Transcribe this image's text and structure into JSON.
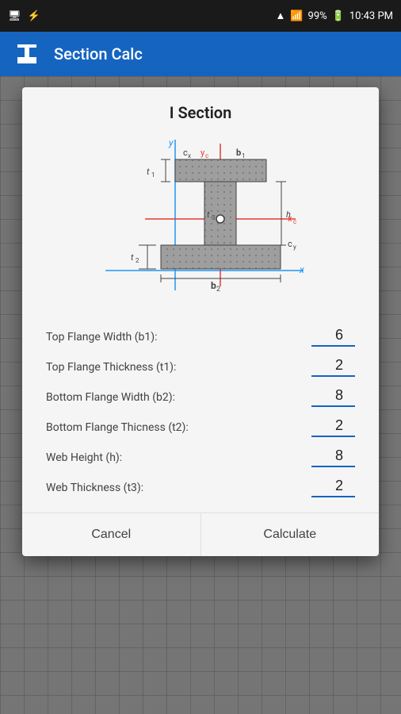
{
  "status_bar": {
    "battery": "99%",
    "time": "10:43 PM",
    "wifi_icon": "wifi",
    "signal_icon": "signal",
    "usb_icon": "usb"
  },
  "app_bar": {
    "title": "Section Calc",
    "icon": "I-beam"
  },
  "dialog": {
    "title": "I Section",
    "fields": [
      {
        "label": "Top Flange Width (b1):",
        "value": "6",
        "name": "b1"
      },
      {
        "label": "Top Flange Thickness (t1):",
        "value": "2",
        "name": "t1"
      },
      {
        "label": "Bottom Flange Width (b2):",
        "value": "8",
        "name": "b2"
      },
      {
        "label": "Bottom Flange Thicness (t2):",
        "value": "2",
        "name": "t2"
      },
      {
        "label": "Web Height (h):",
        "value": "8",
        "name": "h"
      },
      {
        "label": "Web Thickness (t3):",
        "value": "2",
        "name": "t3"
      }
    ],
    "cancel_label": "Cancel",
    "calculate_label": "Calculate"
  }
}
